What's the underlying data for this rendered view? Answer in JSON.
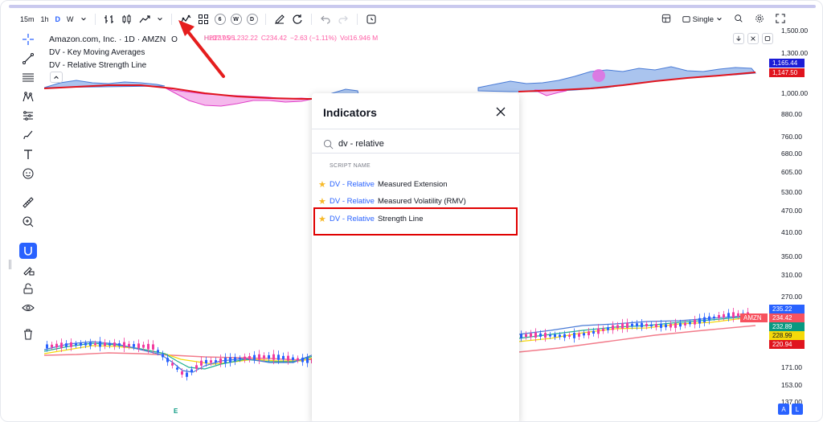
{
  "toolbar": {
    "intervals": [
      "15m",
      "1h",
      "D",
      "W"
    ],
    "active_interval": "D",
    "circle_buttons": [
      "6",
      "W",
      "D"
    ],
    "layout_label": "Single"
  },
  "legend": {
    "symbol": "Amazon.com, Inc. · 1D · AMZN",
    "open_label": "O",
    "high": "H237.95",
    "low": "L232.22",
    "close": "C234.42",
    "change": "−2.63 (−1.11%)",
    "volume": "Vol16.946 M",
    "indicator_1": "DV - Key Moving Averages",
    "indicator_2": "DV - Relative Strength Line"
  },
  "dialog": {
    "title": "Indicators",
    "search_value": "dv - relative",
    "section_label": "SCRIPT NAME",
    "items": [
      {
        "prefix": "DV - Relative",
        "rest": "Measured Extension"
      },
      {
        "prefix": "DV - Relative",
        "rest": "Measured Volatility (RMV)"
      },
      {
        "prefix": "DV - Relative",
        "rest": "Strength Line"
      }
    ]
  },
  "axis": {
    "ticks": [
      "1,500.00",
      "1,300.00",
      "1,000.00",
      "880.00",
      "760.00",
      "680.00",
      "605.00",
      "530.00",
      "470.00",
      "410.00",
      "350.00",
      "310.00",
      "270.00",
      "171.00",
      "153.00",
      "137.00"
    ],
    "badges": [
      {
        "text": "1,165.44",
        "color": "#1c1cd6"
      },
      {
        "text": "1,147.50",
        "color": "#e0141e"
      },
      {
        "text": "235.22",
        "color": "#2962ff"
      },
      {
        "text": "234.42",
        "color": "#f7525f"
      },
      {
        "text": "232.89",
        "color": "#089981"
      },
      {
        "text": "228.99",
        "color": "#f5d90a"
      },
      {
        "text": "220.94",
        "color": "#e0141e"
      }
    ],
    "symbol_badge": "AMZN"
  },
  "chart": {
    "earnings_marker": "E"
  },
  "bottom": {
    "auto_label": "A",
    "log_label": "L"
  },
  "colors": {
    "accent": "#2962ff",
    "highlight": "#e00000",
    "arrow": "#e51d1d"
  }
}
